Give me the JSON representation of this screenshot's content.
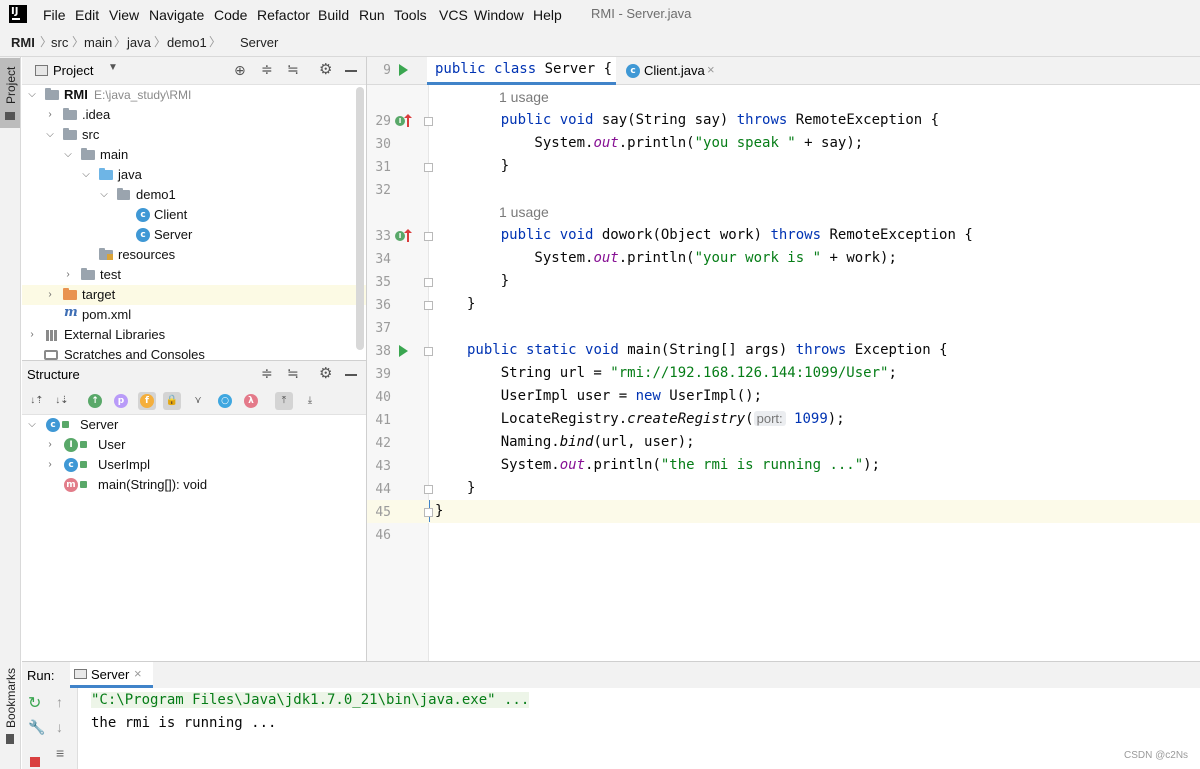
{
  "window": {
    "title": "RMI - Server.java"
  },
  "menu": [
    "File",
    "Edit",
    "View",
    "Navigate",
    "Code",
    "Refactor",
    "Build",
    "Run",
    "Tools",
    "VCS",
    "Window",
    "Help"
  ],
  "breadcrumb": [
    "RMI",
    "src",
    "main",
    "java",
    "demo1",
    "Server"
  ],
  "side_stripe": {
    "project": "Project",
    "bookmarks": "Bookmarks"
  },
  "project_panel": {
    "title": "Project",
    "tree": [
      {
        "label": "RMI",
        "path": "E:\\java_study\\RMI",
        "kind": "module"
      },
      {
        "label": ".idea",
        "kind": "folder"
      },
      {
        "label": "src",
        "kind": "folder"
      },
      {
        "label": "main",
        "kind": "folder"
      },
      {
        "label": "java",
        "kind": "source-folder"
      },
      {
        "label": "demo1",
        "kind": "package"
      },
      {
        "label": "Client",
        "kind": "class"
      },
      {
        "label": "Server",
        "kind": "class"
      },
      {
        "label": "resources",
        "kind": "resources-folder"
      },
      {
        "label": "test",
        "kind": "folder"
      },
      {
        "label": "target",
        "kind": "excluded-folder"
      },
      {
        "label": "pom.xml",
        "kind": "maven-file"
      },
      {
        "label": "External Libraries",
        "kind": "libraries"
      },
      {
        "label": "Scratches and Consoles",
        "kind": "scratches"
      }
    ]
  },
  "structure_panel": {
    "title": "Structure",
    "tree": [
      {
        "label": "Server",
        "icon": "C"
      },
      {
        "label": "User",
        "icon": "I"
      },
      {
        "label": "UserImpl",
        "icon": "C"
      },
      {
        "label": "main(String[]): void",
        "icon": "m"
      }
    ],
    "toolbar_letters": {
      "p": "p",
      "f": "f",
      "lambda": "λ"
    }
  },
  "editor": {
    "sticky": {
      "line": "9",
      "tokens": [
        {
          "t": "public ",
          "c": "kw"
        },
        {
          "t": "class ",
          "c": "kw"
        },
        {
          "t": "Server "
        },
        {
          "t": "{"
        }
      ]
    },
    "other_tab": "Client.java",
    "usage_hint": "1 usage",
    "lines": [
      {
        "n": "29",
        "tokens": [
          {
            "t": "    public ",
            "c": "kw"
          },
          {
            "t": "void ",
            "c": "kw"
          },
          {
            "t": "say(String say) "
          },
          {
            "t": "throws ",
            "c": "kw"
          },
          {
            "t": "RemoteException {"
          }
        ]
      },
      {
        "n": "30",
        "tokens": [
          {
            "t": "        System."
          },
          {
            "t": "out",
            "c": "fld"
          },
          {
            "t": ".println("
          },
          {
            "t": "\"you speak \"",
            "c": "str"
          },
          {
            "t": " + say);"
          }
        ]
      },
      {
        "n": "31",
        "tokens": [
          {
            "t": "    }"
          }
        ]
      },
      {
        "n": "32",
        "tokens": []
      },
      {
        "n": "33",
        "tokens": [
          {
            "t": "    public ",
            "c": "kw"
          },
          {
            "t": "void ",
            "c": "kw"
          },
          {
            "t": "dowork(Object work) "
          },
          {
            "t": "throws ",
            "c": "kw"
          },
          {
            "t": "RemoteException {"
          }
        ]
      },
      {
        "n": "34",
        "tokens": [
          {
            "t": "        System."
          },
          {
            "t": "out",
            "c": "fld"
          },
          {
            "t": ".println("
          },
          {
            "t": "\"your work is \"",
            "c": "str"
          },
          {
            "t": " + work);"
          }
        ]
      },
      {
        "n": "35",
        "tokens": [
          {
            "t": "    }"
          }
        ]
      },
      {
        "n": "36",
        "tokens": [
          {
            "t": "}"
          }
        ]
      },
      {
        "n": "37",
        "tokens": []
      },
      {
        "n": "38",
        "tokens": [
          {
            "t": "public ",
            "c": "kw"
          },
          {
            "t": "static ",
            "c": "kw"
          },
          {
            "t": "void ",
            "c": "kw"
          },
          {
            "t": "main(String[] args) "
          },
          {
            "t": "throws ",
            "c": "kw"
          },
          {
            "t": "Exception {"
          }
        ]
      },
      {
        "n": "39",
        "tokens": [
          {
            "t": "    String url = "
          },
          {
            "t": "\"rmi://192.168.126.144:1099/User\"",
            "c": "str"
          },
          {
            "t": ";"
          }
        ]
      },
      {
        "n": "40",
        "tokens": [
          {
            "t": "    UserImpl user = "
          },
          {
            "t": "new ",
            "c": "kw"
          },
          {
            "t": "UserImpl();"
          }
        ]
      },
      {
        "n": "41",
        "tokens": [
          {
            "t": "    LocateRegistry."
          },
          {
            "t": "createRegistry",
            "c": "it"
          },
          {
            "t": "("
          },
          {
            "t": "port:",
            "c": "hint"
          },
          {
            "t": " 1099",
            "c": "kw"
          },
          {
            "t": ");"
          }
        ]
      },
      {
        "n": "42",
        "tokens": [
          {
            "t": "    Naming."
          },
          {
            "t": "bind",
            "c": "it"
          },
          {
            "t": "(url, user);"
          }
        ]
      },
      {
        "n": "43",
        "tokens": [
          {
            "t": "    System."
          },
          {
            "t": "out",
            "c": "fld"
          },
          {
            "t": ".println("
          },
          {
            "t": "\"the rmi is running ...\"",
            "c": "str"
          },
          {
            "t": ");"
          }
        ]
      },
      {
        "n": "44",
        "tokens": [
          {
            "t": "}"
          }
        ]
      },
      {
        "n": "45",
        "tokens": [
          {
            "t": "}"
          }
        ]
      },
      {
        "n": "46",
        "tokens": []
      }
    ]
  },
  "run_panel": {
    "label": "Run:",
    "tab": "Server",
    "output": [
      "\"C:\\Program Files\\Java\\jdk1.7.0_21\\bin\\java.exe\" ...",
      "the rmi is running ..."
    ]
  },
  "watermark": "CSDN @c2Ns",
  "colors": {
    "keyword": "#0033b3",
    "string": "#067d17",
    "field": "#871094",
    "accent": "#4083c9",
    "caret_line": "#fcfae9"
  }
}
